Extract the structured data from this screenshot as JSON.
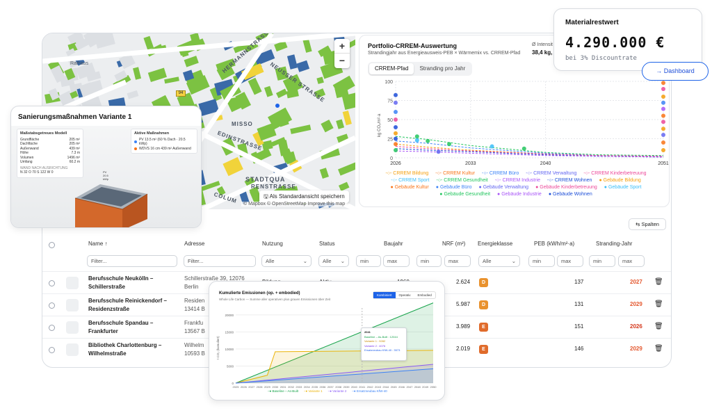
{
  "map": {
    "zoom_in": "+",
    "zoom_out": "−",
    "save_view": "Als Standardansicht speichern",
    "attribution": "© Mapbox © OpenStreetMap  Improve this map",
    "streets": [
      "HERMANNSTRASSE",
      "NEUSSER STRASSE",
      "MISSO",
      "EDINSTRASSE",
      "STADTQUA",
      "RENSTRASSE",
      "COLUM",
      "Rathaus"
    ],
    "road_badge": "94"
  },
  "crrem": {
    "title": "Portfolio-CRREM-Auswertung",
    "subtitle": "Strandingjahr aus Energieausweis-PEB × Wärmemix vs. CRREM-Pfad",
    "stat_label": "Ø Intensit",
    "stat_value": "38,4 kg,",
    "tabs": [
      "CRREM-Pfad",
      "Stranding pro Jahr"
    ],
    "active_tab": 0,
    "legend": [
      {
        "label": "CRREM Bildung",
        "color": "#f59e0b",
        "kind": "line"
      },
      {
        "label": "CRREM Kultur",
        "color": "#f97316",
        "kind": "line"
      },
      {
        "label": "CRREM Büro",
        "color": "#3b82f6",
        "kind": "line"
      },
      {
        "label": "CRREM Verwaltung",
        "color": "#6366f1",
        "kind": "line"
      },
      {
        "label": "CRREM Kinderbetreuung",
        "color": "#ec4899",
        "kind": "line"
      },
      {
        "label": "CRREM Sport",
        "color": "#38bdf8",
        "kind": "line"
      },
      {
        "label": "CRREM Gesundheit",
        "color": "#22c55e",
        "kind": "line"
      },
      {
        "label": "CRREM Industrie",
        "color": "#a855f7",
        "kind": "line"
      },
      {
        "label": "CRREM Wohnen",
        "color": "#1d4ed8",
        "kind": "line"
      },
      {
        "label": "Gebäude Bildung",
        "color": "#f59e0b",
        "kind": "dot"
      },
      {
        "label": "Gebäude Kultur",
        "color": "#f97316",
        "kind": "dot"
      },
      {
        "label": "Gebäude Büro",
        "color": "#3b82f6",
        "kind": "dot"
      },
      {
        "label": "Gebäude Verwaltung",
        "color": "#6366f1",
        "kind": "dot"
      },
      {
        "label": "Gebäude Kinderbetreuung",
        "color": "#ec4899",
        "kind": "dot"
      },
      {
        "label": "Gebäude Sport",
        "color": "#38bdf8",
        "kind": "dot"
      },
      {
        "label": "Gebäude Gesundheit",
        "color": "#22c55e",
        "kind": "dot"
      },
      {
        "label": "Gebäude Industrie",
        "color": "#a855f7",
        "kind": "dot"
      },
      {
        "label": "Gebäude Wohnen",
        "color": "#1d4ed8",
        "kind": "dot"
      }
    ]
  },
  "chart_data": [
    {
      "type": "line",
      "ylabel": "kg CO₂/m²·a",
      "x_ticks": [
        2026,
        2033,
        2040,
        2051
      ],
      "y_ticks": [
        0,
        25,
        50,
        75,
        100
      ],
      "ylim": [
        0,
        100
      ],
      "xlim": [
        2026,
        2051
      ],
      "series": [
        {
          "name": "CRREM Bildung",
          "x": [
            2026,
            2029,
            2033,
            2040,
            2045,
            2051
          ],
          "values": [
            18,
            14,
            10,
            5,
            3,
            2
          ]
        },
        {
          "name": "CRREM Gesundheit",
          "x": [
            2026,
            2029,
            2033,
            2040,
            2045,
            2051
          ],
          "values": [
            28,
            24,
            16,
            7,
            4,
            3
          ]
        },
        {
          "name": "CRREM Wohnen",
          "x": [
            2026,
            2029,
            2033,
            2040,
            2045,
            2051
          ],
          "values": [
            12,
            10,
            8,
            4,
            2,
            1
          ]
        },
        {
          "name": "CRREM Büro",
          "x": [
            2026,
            2029,
            2033,
            2040,
            2045,
            2051
          ],
          "values": [
            22,
            19,
            13,
            6,
            3,
            2
          ]
        },
        {
          "name": "CRREM Kinderbetreuung",
          "x": [
            2026,
            2029,
            2033,
            2040,
            2045,
            2051
          ],
          "values": [
            15,
            12,
            9,
            5,
            3,
            2
          ]
        },
        {
          "name": "CRREM Industrie",
          "x": [
            2026,
            2029,
            2033,
            2040,
            2045,
            2051
          ],
          "values": [
            9,
            8,
            6,
            3,
            2,
            1
          ]
        }
      ],
      "points": [
        {
          "x": 2026,
          "y": 82,
          "series": "Gebäude Wohnen"
        },
        {
          "x": 2026,
          "y": 72,
          "series": "Gebäude Verwaltung"
        },
        {
          "x": 2026,
          "y": 60,
          "series": "Gebäude Büro"
        },
        {
          "x": 2026,
          "y": 50,
          "series": "Gebäude Kinderbetreuung"
        },
        {
          "x": 2026,
          "y": 40,
          "series": "Gebäude Wohnen"
        },
        {
          "x": 2026,
          "y": 32,
          "series": "Gebäude Bildung"
        },
        {
          "x": 2026,
          "y": 25,
          "series": "Gebäude Wohnen"
        },
        {
          "x": 2026,
          "y": 18,
          "series": "Gebäude Kultur"
        },
        {
          "x": 2026,
          "y": 10,
          "series": "Gebäude Gesundheit"
        },
        {
          "x": 2028,
          "y": 28,
          "series": "Gebäude Gesundheit"
        },
        {
          "x": 2029,
          "y": 22,
          "series": "Gebäude Gesundheit"
        },
        {
          "x": 2031,
          "y": 18,
          "series": "Gebäude Gesundheit"
        },
        {
          "x": 2030,
          "y": 8,
          "series": "Gebäude Verwaltung"
        },
        {
          "x": 2028,
          "y": 23,
          "series": "Gebäude Sport"
        },
        {
          "x": 2035,
          "y": 15,
          "series": "Gebäude Sport"
        },
        {
          "x": 2038,
          "y": 12,
          "series": "Gebäude Gesundheit"
        },
        {
          "x": 2051,
          "y": 98,
          "series": "Gebäude Kultur"
        },
        {
          "x": 2051,
          "y": 90,
          "series": "Gebäude Kinderbetreuung"
        },
        {
          "x": 2051,
          "y": 80,
          "series": "Gebäude Bildung"
        },
        {
          "x": 2051,
          "y": 72,
          "series": "Gebäude Büro"
        },
        {
          "x": 2051,
          "y": 64,
          "series": "Gebäude Industrie"
        },
        {
          "x": 2051,
          "y": 55,
          "series": "Gebäude Kultur"
        },
        {
          "x": 2051,
          "y": 47,
          "series": "Gebäude Kinderbetreuung"
        },
        {
          "x": 2051,
          "y": 38,
          "series": "Gebäude Bildung"
        },
        {
          "x": 2051,
          "y": 30,
          "series": "Gebäude Verwaltung"
        },
        {
          "x": 2051,
          "y": 20,
          "series": "Gebäude Kultur"
        },
        {
          "x": 2051,
          "y": 10,
          "series": "Gebäude Bildung"
        }
      ]
    },
    {
      "type": "area",
      "title": "Kumulierte Emissionen (op. + embodied)",
      "subtitle": "Whole Life Carbon — Summe aller operativen plus grauen Emissionen über Zeit",
      "ylabel": "t CO₂ (kumuliert)",
      "x_ticks": [
        2025,
        2026,
        2027,
        2028,
        2029,
        2030,
        2031,
        2032,
        2033,
        2034,
        2035,
        2036,
        2037,
        2038,
        2039,
        2040,
        2041,
        2042,
        2043,
        2044,
        2045,
        2046,
        2047,
        2048,
        2049,
        2050
      ],
      "y_ticks": [
        0,
        5000,
        10000,
        15000,
        20000
      ],
      "ylim": [
        0,
        22000
      ],
      "series": [
        {
          "name": "Baseline – As-Built",
          "x": [
            2025,
            2050
          ],
          "values": [
            0,
            23500
          ]
        },
        {
          "name": "Variante 1",
          "x": [
            2025,
            2029,
            2030,
            2050
          ],
          "values": [
            0,
            2300,
            9200,
            9600
          ]
        },
        {
          "name": "Variante 2",
          "x": [
            2025,
            2050
          ],
          "values": [
            0,
            5500
          ]
        },
        {
          "name": "Ersatzneubau KfW-40",
          "x": [
            2025,
            2050
          ],
          "values": [
            0,
            4200
          ]
        }
      ]
    }
  ],
  "material": {
    "label": "Materialrestwert",
    "value": "4.290.000 €",
    "sub": "bei 3% Discountrate"
  },
  "dashboard_button": "Dashboard",
  "sanierung": {
    "title": "Sanierungsmaßnahmen Variante 1",
    "model_title": "Maßstabsgetreues Modell",
    "model_rows": [
      {
        "k": "Grundfläche",
        "v": "205 m²"
      },
      {
        "k": "Dachfläche",
        "v": "205 m²"
      },
      {
        "k": "Außenwand",
        "v": "439 m²"
      },
      {
        "k": "Höhe",
        "v": "7.3 m"
      },
      {
        "k": "Volumen",
        "v": "1496 m³"
      },
      {
        "k": "Umfang",
        "v": "60.2 m"
      }
    ],
    "orient_label": "WAND NACH AUSRICHTUNG",
    "orient_values": "N 32  O 70  S 122  W 0",
    "measures_title": "Aktive Maßnahmen",
    "measures": [
      {
        "label": "PV 13.5 m² (60 % Dach · 20.5 kWp)",
        "color": "#3b82f6"
      },
      {
        "label": "WDVS 16 cm  439 m² Außenwand",
        "color": "#f97316"
      }
    ],
    "pv_label": "PV\n20.5\nkWp"
  },
  "table": {
    "columns_button": "Spalten",
    "headers": {
      "name": "Name ↑",
      "address": "Adresse",
      "usage": "Nutzung",
      "status": "Status",
      "year": "Baujahr",
      "nrf": "NRF (m²)",
      "energy": "Energieklasse",
      "peb": "PEB (kWh/m²·a)",
      "stranding": "Stranding-Jahr"
    },
    "filters": {
      "name_placeholder": "Filter...",
      "address_placeholder": "Filter...",
      "usage": "Alle",
      "status": "Alle",
      "min": "min",
      "max": "max",
      "energy": "Alle"
    },
    "rows": [
      {
        "name": "Berufsschule Neukölln –\nSchillerstraße",
        "address": "Schillerstraße 39, 12076\nBerlin",
        "usage": "Bildung",
        "status": "Aktiv",
        "year": "1960",
        "nrf": "2.624",
        "class": "D",
        "class_color": "#e9922e",
        "peb": "137",
        "stranding": "2027"
      },
      {
        "name": "Berufsschule Reinickendorf –\nResidenzstraße",
        "address": "Residen\n13414 B",
        "usage": "",
        "status": "",
        "year": "",
        "nrf": "5.987",
        "class": "D",
        "class_color": "#e9922e",
        "peb": "131",
        "stranding": "2029"
      },
      {
        "name": "Berufsschule Spandau –\nFrankfurter",
        "address": "Frankfu\n13567 B",
        "usage": "",
        "status": "",
        "year": "",
        "nrf": "3.989",
        "class": "E",
        "class_color": "#e06b2b",
        "peb": "151",
        "stranding": "2026"
      },
      {
        "name": "Bibliothek Charlottenburg –\nWilhelmstraße",
        "address": "Wilhelm\n10593 B",
        "usage": "",
        "status": "",
        "year": "",
        "nrf": "2.019",
        "class": "E",
        "class_color": "#e06b2b",
        "peb": "146",
        "stranding": "2029"
      }
    ]
  },
  "emissions": {
    "tabs": [
      "Kombiniert",
      "Operativ",
      "Embodied"
    ],
    "active_tab": 0,
    "tooltip": {
      "year": "2041",
      "lines": [
        "Baseline – As-Built : 12044",
        "Variante 1 : 9282",
        "Variante 2 : 4076",
        "Ersatzneubau KfW-40 : 3573"
      ]
    },
    "legend": [
      {
        "label": "Baseline – As-Built",
        "color": "#16a34a"
      },
      {
        "label": "Variante 1",
        "color": "#eab308"
      },
      {
        "label": "Variante 2",
        "color": "#8b5cf6"
      },
      {
        "label": "Ersatzneubau KfW-40",
        "color": "#3b82f6"
      }
    ],
    "colors": {
      "baseline": "#16a34a",
      "v1": "#eab308",
      "v2": "#8b5cf6",
      "kfw": "#3b82f6"
    }
  },
  "colors": {
    "accent": "#1d63e8",
    "stranding": "#e4572e",
    "stranding_dark": "#d4381c",
    "map_green": "#7cc242",
    "map_blue": "#3a6aa8"
  }
}
